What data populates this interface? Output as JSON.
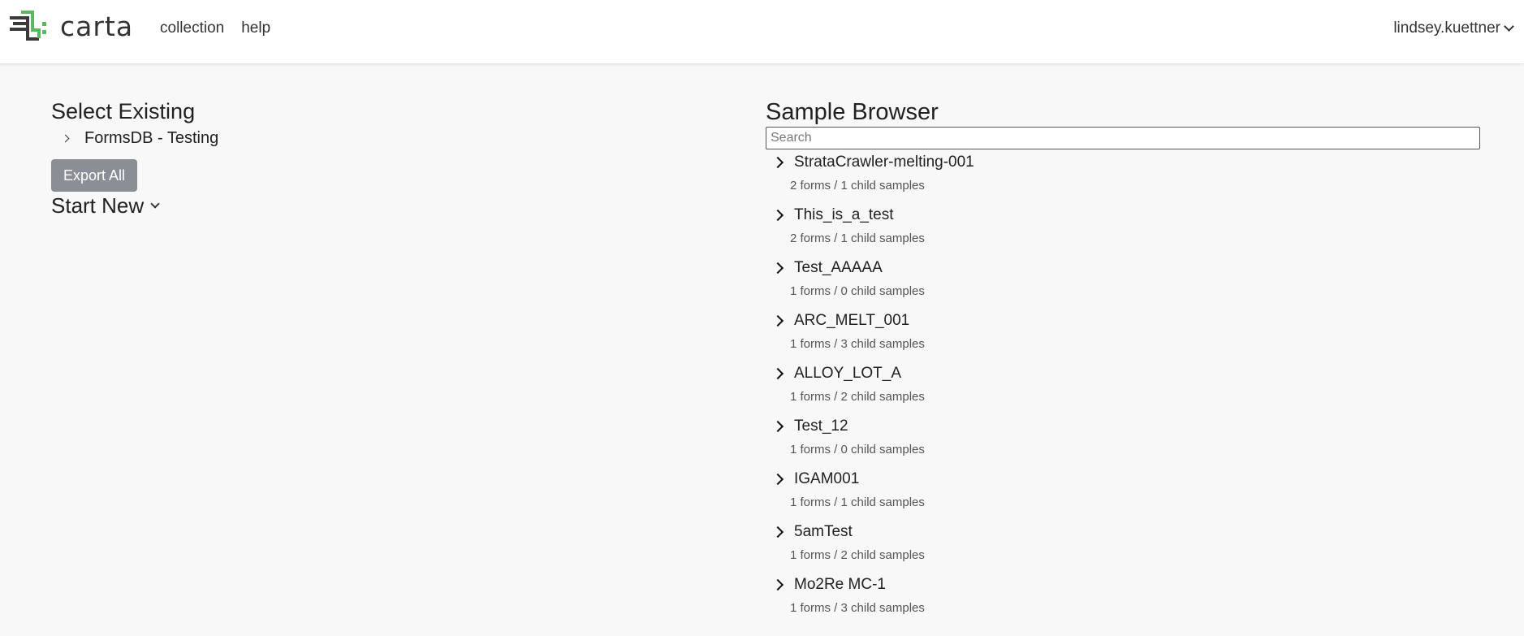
{
  "header": {
    "brand": "carta",
    "nav": [
      "collection",
      "help"
    ],
    "user": "lindsey.kuettner"
  },
  "left": {
    "select_existing_title": "Select Existing",
    "tree_item": "FormsDB - Testing",
    "export_label": "Export All",
    "start_new_label": "Start New"
  },
  "browser": {
    "title": "Sample Browser",
    "search_placeholder": "Search",
    "samples": [
      {
        "name": "StrataCrawler-melting-001",
        "meta": "2 forms / 1 child samples"
      },
      {
        "name": "This_is_a_test",
        "meta": "2 forms / 1 child samples"
      },
      {
        "name": "Test_AAAAA",
        "meta": "1 forms / 0 child samples"
      },
      {
        "name": "ARC_MELT_001",
        "meta": "1 forms / 3 child samples"
      },
      {
        "name": "ALLOY_LOT_A",
        "meta": "1 forms / 2 child samples"
      },
      {
        "name": "Test_12",
        "meta": "1 forms / 0 child samples"
      },
      {
        "name": "IGAM001",
        "meta": "1 forms / 1 child samples"
      },
      {
        "name": "5amTest",
        "meta": "1 forms / 2 child samples"
      },
      {
        "name": "Mo2Re MC-1",
        "meta": "1 forms / 3 child samples"
      }
    ]
  },
  "colors": {
    "logo_green": "#5cb85c",
    "logo_dark": "#3a3a3a",
    "button_gray": "#8a8f95",
    "page_bg": "#f8f8f8"
  }
}
